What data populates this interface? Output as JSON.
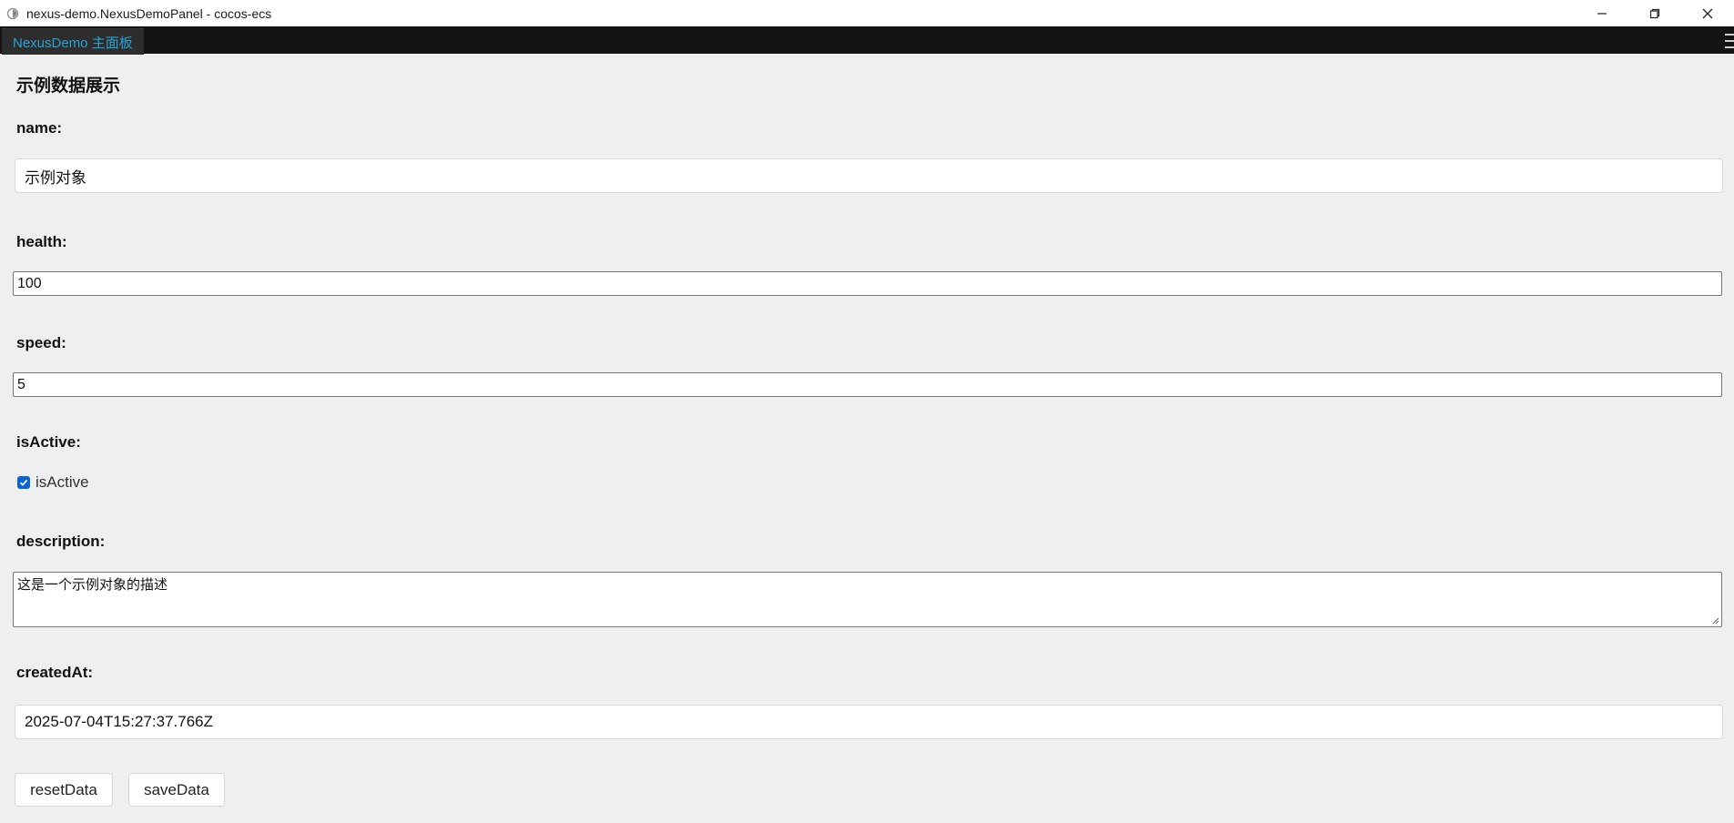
{
  "window": {
    "title": "nexus-demo.NexusDemoPanel - cocos-ecs"
  },
  "tabs": [
    {
      "label": "NexusDemo 主面板",
      "active": true
    }
  ],
  "panel": {
    "section_title": "示例数据展示",
    "fields": {
      "name": {
        "label": "name:",
        "value": "示例对象"
      },
      "health": {
        "label": "health:",
        "value": "100"
      },
      "speed": {
        "label": "speed:",
        "value": "5"
      },
      "isActive": {
        "label": "isActive:",
        "checkbox_label": "isActive",
        "checked": true
      },
      "description": {
        "label": "description:",
        "value": "这是一个示例对象的描述"
      },
      "createdAt": {
        "label": "createdAt:",
        "value": "2025-07-04T15:27:37.766Z"
      }
    },
    "buttons": {
      "reset_label": "resetData",
      "save_label": "saveData"
    }
  },
  "colors": {
    "tab_text": "#29a3d6",
    "tab_strip_bg": "#141414",
    "panel_bg": "#efefef",
    "checkbox_accent": "#0a63d6"
  },
  "icons": [
    "app-icon",
    "minimize-icon",
    "restore-icon",
    "close-icon",
    "menu-icon",
    "checkmark-icon",
    "resize-grip-icon"
  ]
}
